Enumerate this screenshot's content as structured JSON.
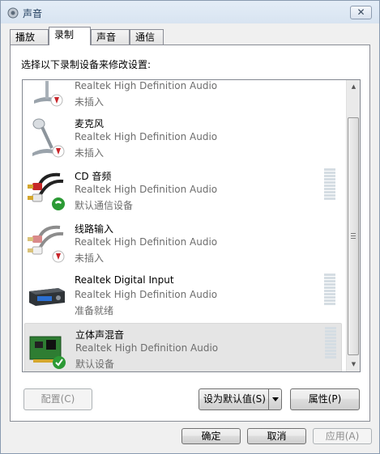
{
  "window": {
    "title": "声音",
    "close_glyph": "✕"
  },
  "tabs": [
    {
      "label": "播放"
    },
    {
      "label": "录制"
    },
    {
      "label": "声音"
    },
    {
      "label": "通信"
    }
  ],
  "instruction": "选择以下录制设备来修改设置:",
  "devices": [
    {
      "name": "",
      "driver": "Realtek High Definition Audio",
      "status": "未插入",
      "icon": "microphone-icon",
      "badge": "unplugged-badge"
    },
    {
      "name": "麦克风",
      "driver": "Realtek High Definition Audio",
      "status": "未插入",
      "icon": "microphone-icon",
      "badge": "unplugged-badge"
    },
    {
      "name": "CD 音频",
      "driver": "Realtek High Definition Audio",
      "status": "默认通信设备",
      "icon": "rca-cable-icon",
      "badge": "phone-badge"
    },
    {
      "name": "线路输入",
      "driver": "Realtek High Definition Audio",
      "status": "未插入",
      "icon": "rca-cable-icon",
      "badge": "unplugged-badge"
    },
    {
      "name": "Realtek Digital Input",
      "driver": "Realtek High Definition Audio",
      "status": "准备就绪",
      "icon": "digital-receiver-icon",
      "badge": ""
    },
    {
      "name": "立体声混音",
      "driver": "Realtek High Definition Audio",
      "status": "默认设备",
      "icon": "sound-card-icon",
      "badge": "default-check-badge"
    }
  ],
  "buttons": {
    "configure": "配置(C)",
    "set_default": "设为默认值(S)",
    "properties": "属性(P)",
    "ok": "确定",
    "cancel": "取消",
    "apply": "应用(A)"
  },
  "colors": {
    "unplugged": "#c8262b",
    "default_check": "#2c9a35",
    "selection": "#e5e5e5"
  }
}
